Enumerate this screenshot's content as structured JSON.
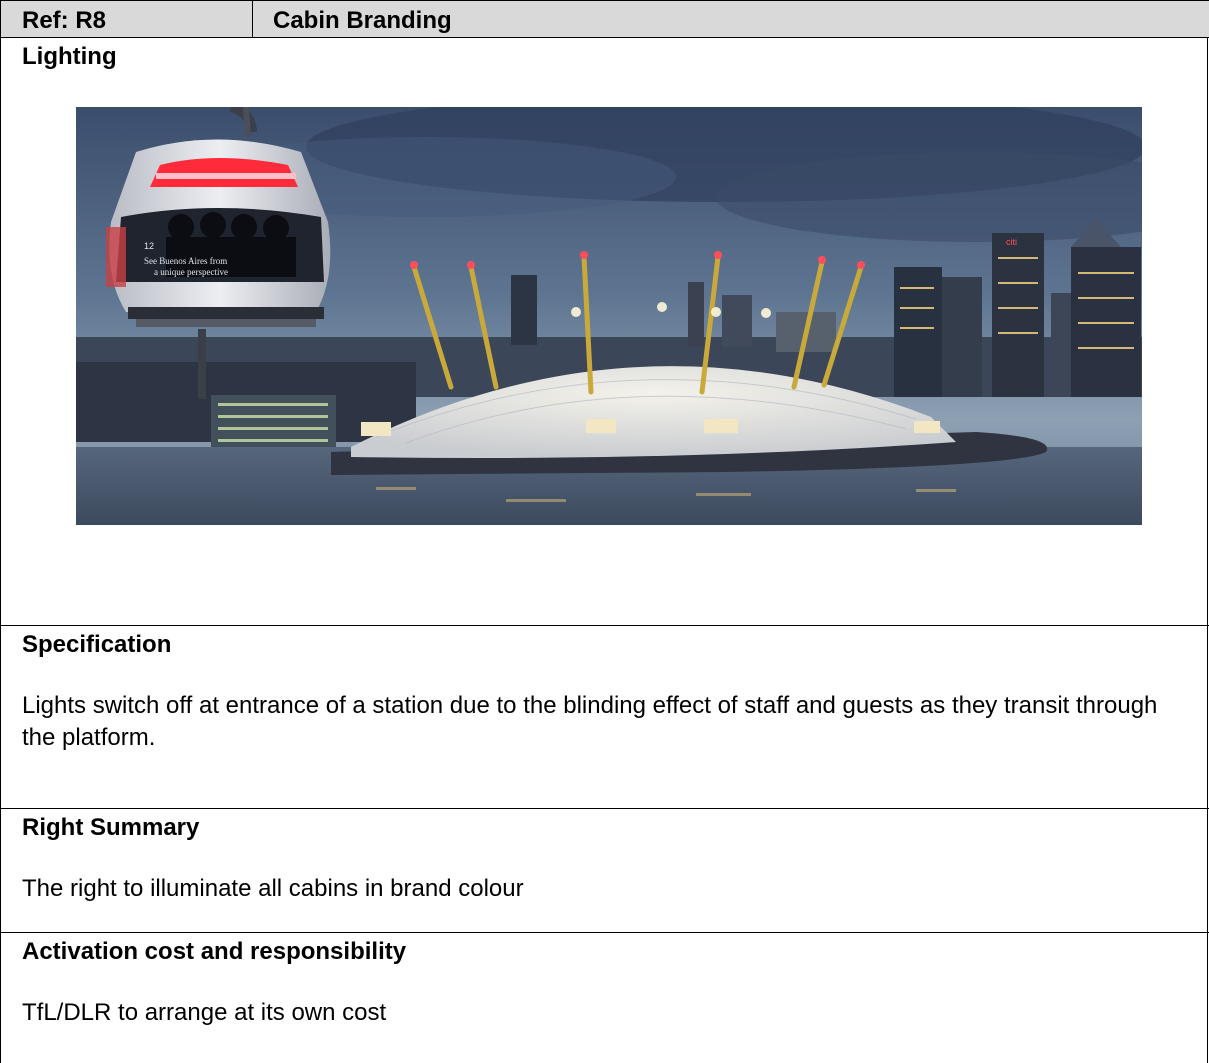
{
  "header": {
    "ref": "Ref: R8",
    "title": "Cabin Branding"
  },
  "lighting": {
    "title": "Lighting",
    "photo": {
      "cabin_number": "12",
      "cabin_text_line1": "See Buenos Aires from",
      "cabin_text_line2": "a unique perspective",
      "building_sign": "citi"
    }
  },
  "specification": {
    "title": "Specification",
    "body": "Lights switch off at entrance of a station due to the blinding effect of staff and guests as they transit through the platform."
  },
  "right_summary": {
    "title": "Right Summary",
    "body": "The right to illuminate all cabins in brand colour"
  },
  "activation": {
    "title": "Activation cost and responsibility",
    "body": "TfL/DLR to arrange at its own cost"
  },
  "colors": {
    "header_bg": "#d9d9d9",
    "cabin_light": "#ff2a3a"
  }
}
